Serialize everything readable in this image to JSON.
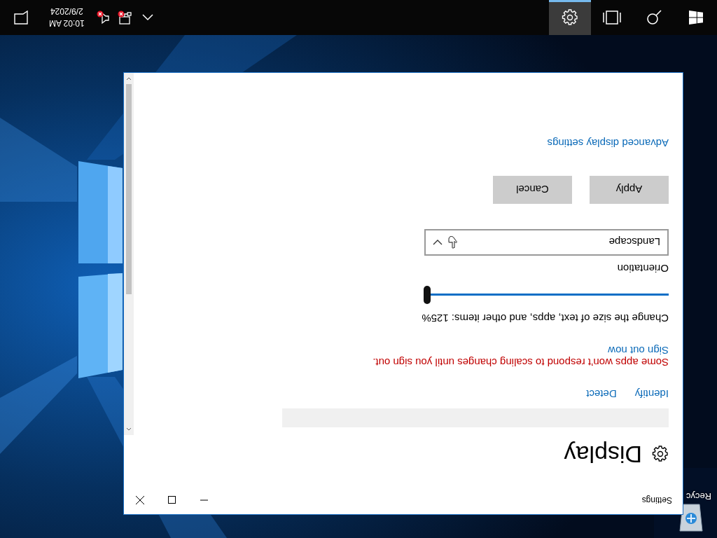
{
  "desktop": {
    "icons": [
      {
        "label": "Recyc"
      }
    ]
  },
  "window": {
    "title": "Settings",
    "page": {
      "title": "Display",
      "links": [
        "Identify",
        "Detect"
      ],
      "warning": "Some apps won’t respond to scaling changes until you sign out.",
      "sign_out_link": "Sign out now",
      "scale": {
        "label": "Change the size of text, apps, and other items: 125%",
        "level": 1
      },
      "orientation": {
        "label": "Orientation",
        "value": "Landscape"
      },
      "buttons": [
        "Apply",
        "Cancel"
      ],
      "advanced_link": "Advanced display settings"
    }
  },
  "taskbar": {
    "items": [
      {
        "kind": "start",
        "selected": false
      },
      {
        "kind": "search",
        "selected": false
      },
      {
        "kind": "task-view",
        "selected": false
      },
      {
        "kind": "settings",
        "selected": true
      }
    ],
    "tray": [
      {
        "kind": "chevron"
      },
      {
        "kind": "network"
      },
      {
        "kind": "volume"
      }
    ],
    "clock": {
      "time": "10:02 AM",
      "date": "2/9/2024"
    }
  }
}
